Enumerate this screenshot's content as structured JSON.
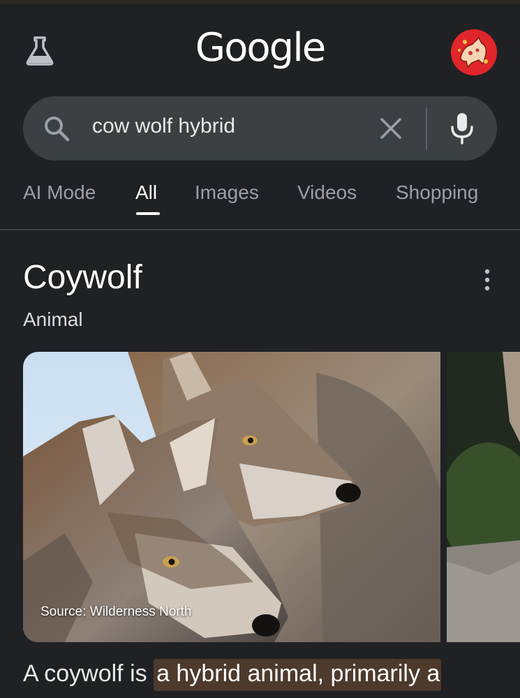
{
  "header": {
    "logo_text": "Google",
    "labs_icon": "flask-icon",
    "avatar_icon": "profile-avatar"
  },
  "search": {
    "query": "cow wolf hybrid",
    "search_icon": "search-icon",
    "clear_icon": "close-icon",
    "voice_icon": "mic-icon"
  },
  "tabs": [
    {
      "label": "AI Mode",
      "active": false
    },
    {
      "label": "All",
      "active": true
    },
    {
      "label": "Images",
      "active": false
    },
    {
      "label": "Videos",
      "active": false
    },
    {
      "label": "Shopping",
      "active": false
    }
  ],
  "knowledge_panel": {
    "title": "Coywolf",
    "subtitle": "Animal",
    "image_source": "Source: Wilderness North",
    "description_start": "A coywolf is ",
    "description_highlight": "a hybrid animal, primarily a"
  },
  "colors": {
    "background": "#202124",
    "searchbar": "#3c4043",
    "highlight": "#4d3a2c",
    "avatar": "#e0262b"
  }
}
